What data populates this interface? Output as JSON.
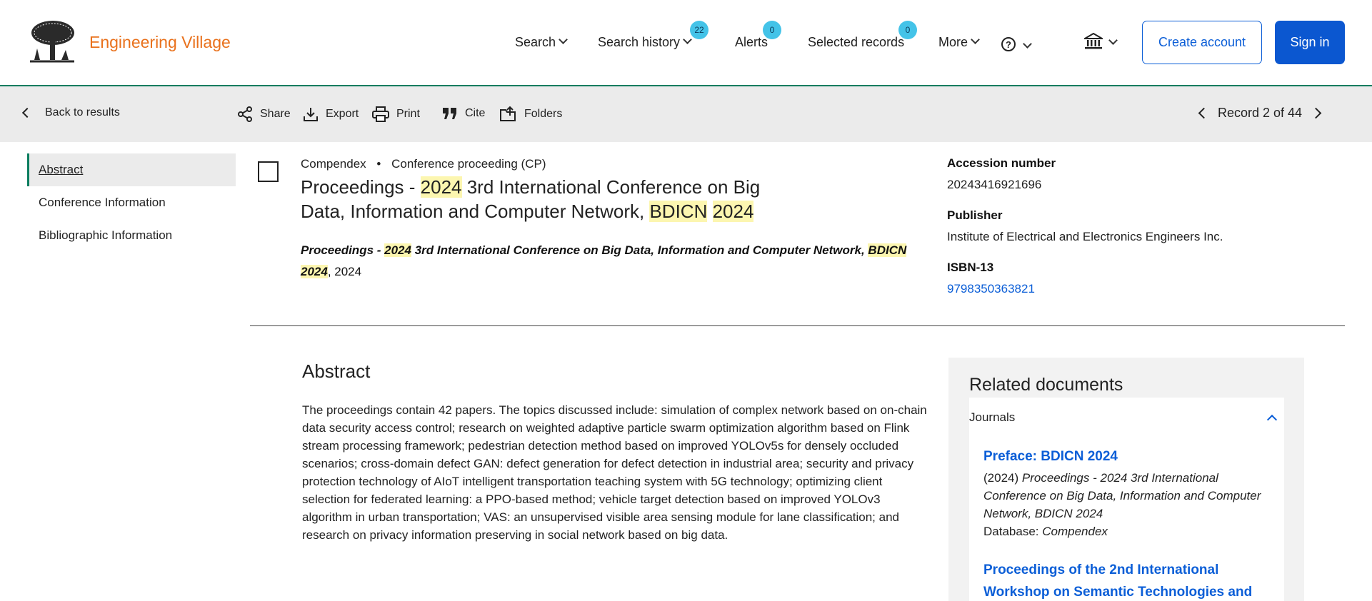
{
  "header": {
    "brand": "Engineering Village",
    "nav": {
      "search": "Search",
      "search_history": "Search history",
      "search_history_count": "22",
      "alerts": "Alerts",
      "alerts_count": "0",
      "selected_records": "Selected records",
      "selected_records_count": "0",
      "more": "More",
      "help_glyph": "?"
    },
    "create_account": "Create account",
    "sign_in": "Sign in"
  },
  "toolbar": {
    "back": "Back to results",
    "share": "Share",
    "export": "Export",
    "print": "Print",
    "cite": "Cite",
    "folders": "Folders",
    "record_position": "Record 2 of 44"
  },
  "sidebar": {
    "items": [
      {
        "label": "Abstract"
      },
      {
        "label": "Conference Information"
      },
      {
        "label": "Bibliographic Information"
      }
    ]
  },
  "record": {
    "database": "Compendex",
    "separator": "•",
    "doc_type": "Conference proceeding (CP)",
    "title": {
      "p1": "Proceedings - ",
      "h1": "2024",
      "p2": " 3rd International Conference on Big Data, Information and Computer Network, ",
      "h2": "BDICN",
      "p3": " ",
      "h3": "2024"
    },
    "source": {
      "p1": "Proceedings - ",
      "h1": "2024",
      "p2": " 3rd International Conference on Big Data, Information and Computer Network, ",
      "h2": "BDICN",
      "p3": " ",
      "h3": "2024",
      "tail": ", 2024"
    },
    "accession_label": "Accession number",
    "accession_value": "20243416921696",
    "publisher_label": "Publisher",
    "publisher_value": "Institute of Electrical and Electronics Engineers Inc.",
    "isbn_label": "ISBN-13",
    "isbn_value": "9798350363821"
  },
  "abstract": {
    "heading": "Abstract",
    "text": "The proceedings contain 42 papers. The topics discussed include: simulation of complex network based on on-chain data security access control; research on weighted adaptive particle swarm optimization algorithm based on Flink stream processing framework; pedestrian detection method based on improved YOLOv5s for densely occluded scenarios; cross-domain defect GAN: defect generation for defect detection in industrial area; security and privacy protection technology of AIoT intelligent transportation teaching system with 5G technology; optimizing client selection for federated learning: a PPO-based method; vehicle target detection based on improved YOLOv3 algorithm in urban transportation; VAS: an unsupervised visible area sensing module for lane classification; and research on privacy information preserving in social network based on big data."
  },
  "related": {
    "heading": "Related documents",
    "tab": "Journals",
    "docs": [
      {
        "title": "Preface: BDICN 2024",
        "year": "(2024)",
        "source": "Proceedings - 2024 3rd International Conference on Big Data, Information and Computer Network, BDICN 2024",
        "db_label": "Database:",
        "db": "Compendex"
      },
      {
        "title": "Proceedings of the 2nd International Workshop on Semantic Technologies and"
      }
    ]
  },
  "colors": {
    "brand": "#e9711c",
    "accent": "#0b57d0",
    "highlight": "#fcf6b0",
    "badge": "#44c3e8",
    "rule": "#0c7d5f"
  },
  "icons": [
    "logo-tree-icon",
    "chevron-down-icon",
    "help-icon",
    "institution-icon",
    "chevron-left-icon",
    "share-icon",
    "export-icon",
    "print-icon",
    "cite-icon",
    "folders-icon",
    "chevron-right-icon",
    "chevron-up-icon"
  ]
}
